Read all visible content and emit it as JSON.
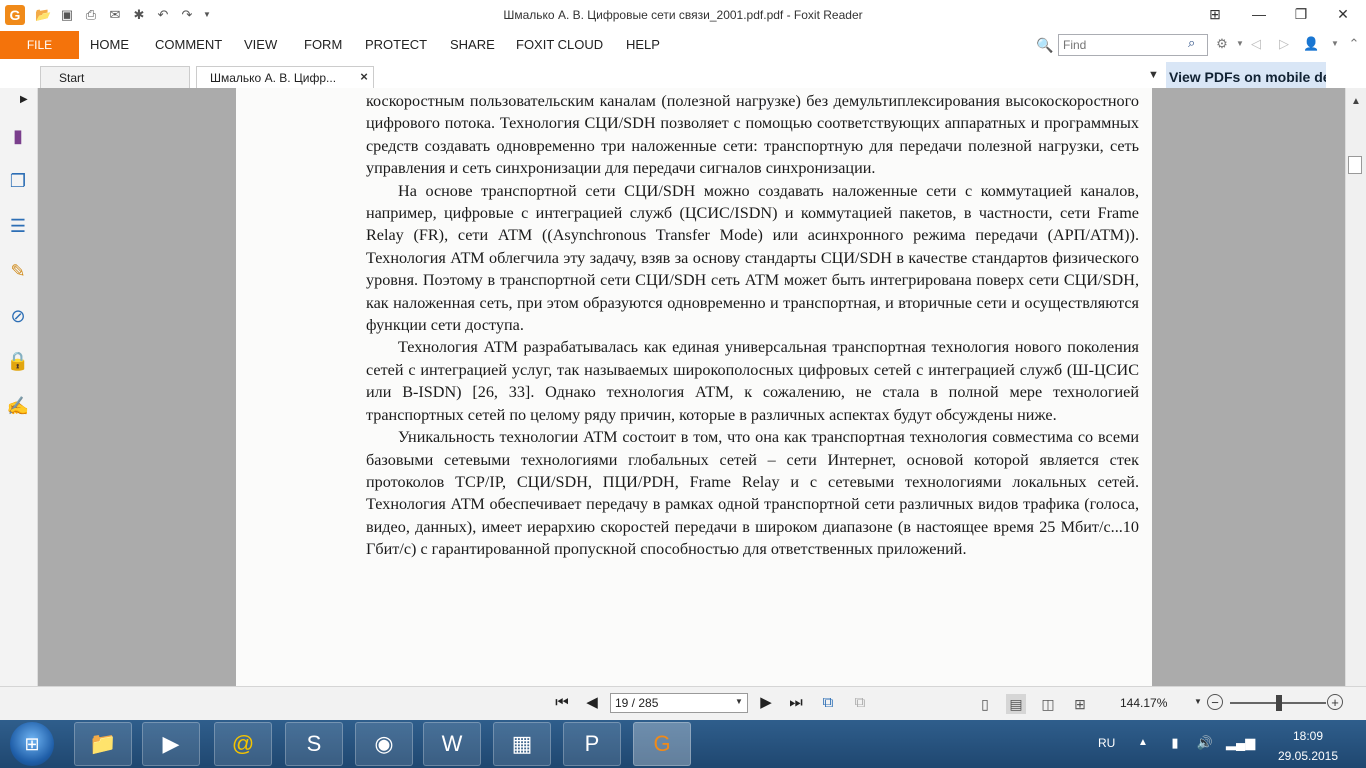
{
  "window": {
    "title": "Шмалько А. В. Цифровые сети связи_2001.pdf.pdf - Foxit Reader",
    "app_icon": "G"
  },
  "menu": {
    "file": "FILE",
    "items": [
      "HOME",
      "COMMENT",
      "VIEW",
      "FORM",
      "PROTECT",
      "SHARE",
      "FOXIT CLOUD",
      "HELP"
    ]
  },
  "find": {
    "placeholder": "Find"
  },
  "tabs": {
    "start": "Start",
    "doc": "Шмалько А. В. Цифр...",
    "close": "×"
  },
  "banner": "View PDFs on mobile de",
  "document": {
    "paragraphs": [
      "коскоростным пользовательским каналам (полезной нагрузке) без демультиплексирования высокоскоростного цифрового потока. Технология СЦИ/SDH позволяет с помощью соответствующих аппаратных и программных средств создавать одновременно три наложенные сети: транспортную для передачи полезной нагрузки, сеть управления и сеть синхронизации для передачи сигналов синхронизации.",
      "На основе транспортной сети СЦИ/SDH можно создавать наложенные сети с коммутацией каналов, например, цифровые с интеграцией служб (ЦСИС/ISDN) и коммутацией пакетов, в частности, сети Frame Relay (FR), сети АТМ ((Asynchronous Transfer Mode) или асинхронного режима передачи (АРП/АТМ)). Технология АТМ облегчила эту задачу, взяв за основу стандарты СЦИ/SDH в качестве стандартов физического уровня. Поэтому в транспортной сети СЦИ/SDH сеть АТМ может быть интегрирована поверх сети СЦИ/SDH, как наложенная сеть, при этом образуются одновременно и транспортная, и вторичные сети и осуществляются функции сети доступа.",
      "Технология АТМ разрабатывалась как единая универсальная транспортная технология нового поколения сетей с интеграцией услуг, так называемых широкополосных цифровых сетей с интеграцией служб (Ш-ЦСИС или B-ISDN) [26, 33]. Однако технология АТМ, к сожалению, не стала в полной мере технологией транспортных сетей по целому ряду причин, которые в различных аспектах будут обсуждены ниже.",
      "Уникальность технологии АТМ состоит в том, что она как транспортная технология совместима со всеми базовыми сетевыми технологиями глобальных сетей – сети Интернет, основой которой является стек протоколов TCP/IP, СЦИ/SDH, ПЦИ/PDH, Frame Relay и с сетевыми технологиями локальных сетей. Технология АТМ обеспечивает передачу в рамках одной транспортной сети различных видов трафика (голоса, видео, данных), имеет иерархию скоростей передачи в широком диапазоне (в настоящее время 25 Мбит/с...10 Гбит/с) с гарантированной пропускной способностью для ответственных приложений."
    ]
  },
  "status": {
    "page_value": "19 / 285",
    "zoom": "144.17%",
    "zoom_level_fraction": 0.48
  },
  "taskbar": {
    "lang": "RU",
    "time": "18:09",
    "date": "29.05.2015"
  },
  "colors": {
    "file_tab": "#f4730b",
    "foxit_orange": "#f08a19",
    "taskbar": "#1f4770"
  }
}
